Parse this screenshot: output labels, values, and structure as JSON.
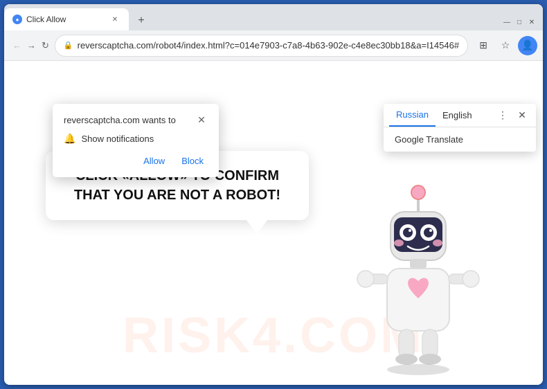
{
  "browser": {
    "tab": {
      "favicon": "●",
      "title": "Click Allow",
      "close_label": "✕"
    },
    "new_tab_label": "+",
    "window_controls": {
      "minimize": "—",
      "maximize": "□",
      "close": "✕"
    },
    "nav": {
      "back": "←",
      "forward": "→",
      "reload": "↻"
    },
    "url": "reverscaptcha.com/robot4/index.html?c=014e7903-c7a8-4b63-902e-c4e8ec30bb18&a=I14546#",
    "lock_icon": "🔒",
    "actions": {
      "extensions": "⊞",
      "bookmark": "☆",
      "profile": "👤",
      "menu": "⋮"
    }
  },
  "notification_popup": {
    "title": "reverscaptcha.com wants to",
    "close_label": "✕",
    "bell_icon": "🔔",
    "notification_text": "Show notifications",
    "allow_button": "Allow",
    "block_button": "Block"
  },
  "translate_dropdown": {
    "tab_russian": "Russian",
    "tab_english": "English",
    "menu_icon": "⋮",
    "close_label": "✕",
    "option": "Google Translate"
  },
  "page": {
    "watermark": "RISK4.COM",
    "bubble_text": "CLICK «ALLOW» TO CONFIRM THAT YOU ARE NOT A ROBOT!"
  },
  "colors": {
    "browser_frame": "#2a5db0",
    "allow_button": "#1a73e8",
    "block_button": "#1a73e8",
    "active_tab_underline": "#1a73e8"
  }
}
